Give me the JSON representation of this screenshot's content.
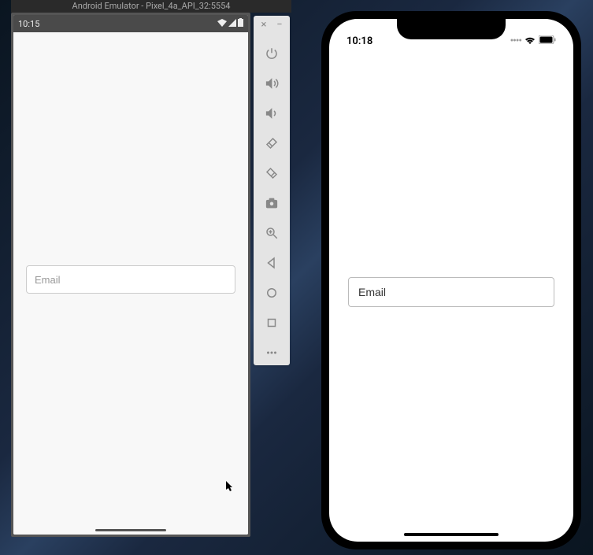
{
  "android": {
    "window_title": "Android Emulator - Pixel_4a_API_32:5554",
    "statusbar": {
      "time": "10:15"
    },
    "input": {
      "placeholder": "Email"
    }
  },
  "toolbar": {
    "buttons": [
      "close",
      "minimize",
      "power",
      "volume-up",
      "volume-down",
      "rotate-left",
      "rotate-right",
      "camera",
      "zoom",
      "back",
      "home",
      "overview",
      "more"
    ]
  },
  "iphone": {
    "statusbar": {
      "time": "10:18"
    },
    "input": {
      "placeholder": "Email"
    }
  }
}
